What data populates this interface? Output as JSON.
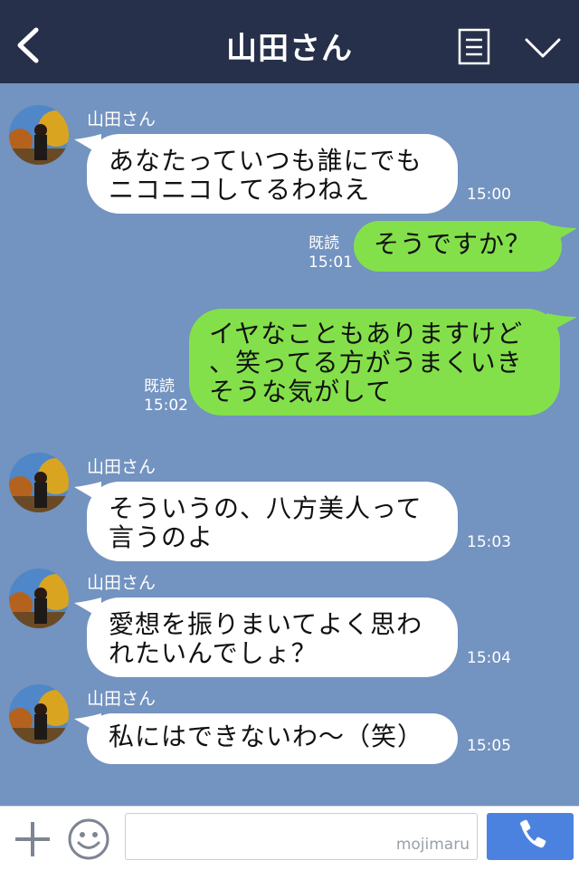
{
  "header": {
    "title": "山田さん"
  },
  "messages": [
    {
      "direction": "in",
      "sender": "山田さん",
      "lines": [
        "あなたっていつも誰にでも",
        "ニコニコしてるわねえ"
      ],
      "time": "15:00"
    },
    {
      "direction": "out",
      "read": "既読",
      "lines": [
        "そうですか？"
      ],
      "time": "15:01"
    },
    {
      "direction": "out",
      "read": "既読",
      "lines": [
        "イヤなこともありますけど",
        "、笑ってる方がうまくいき",
        "そうな気がして"
      ],
      "time": "15:02"
    },
    {
      "direction": "in",
      "sender": "山田さん",
      "lines": [
        "そういうの、八方美人って",
        "言うのよ"
      ],
      "time": "15:03"
    },
    {
      "direction": "in",
      "sender": "山田さん",
      "lines": [
        "愛想を振りまいてよく思わ",
        "れたいんでしょ？"
      ],
      "time": "15:04"
    },
    {
      "direction": "in",
      "sender": "山田さん",
      "lines": [
        "私にはできないわ〜（笑）"
      ],
      "time": "15:05"
    }
  ],
  "footer": {
    "watermark": "mojimaru"
  },
  "icons": {
    "back": "chevron-left-icon",
    "menu": "document-icon",
    "collapse": "chevron-down-icon",
    "plus": "plus-icon",
    "emoji": "smiley-icon",
    "call": "phone-icon"
  },
  "colors": {
    "header": "#27304a",
    "background": "#7393c0",
    "incoming_bubble": "#ffffff",
    "outgoing_bubble": "#83e04a",
    "call_button": "#4b82e0"
  }
}
